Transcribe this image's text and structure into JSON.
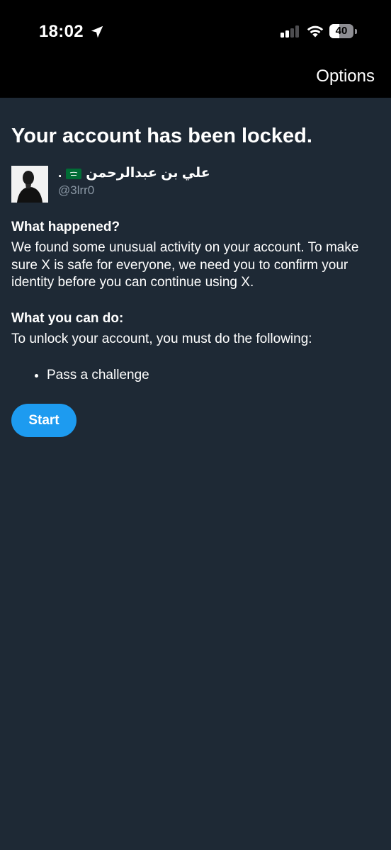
{
  "status_bar": {
    "time": "18:02",
    "battery": "40",
    "battery_level_percent": 40,
    "icons": [
      "location-arrow-icon",
      "cellular-signal-icon",
      "wifi-icon",
      "battery-icon"
    ]
  },
  "header": {
    "options_label": "Options"
  },
  "page": {
    "title": "Your account has been locked."
  },
  "user": {
    "display_name": "علي بن عبدالرحمن",
    "name_suffix": ".",
    "flag": "saudi-arabia-flag-icon",
    "handle": "@3lrr0"
  },
  "what_happened": {
    "heading": "What happened?",
    "body": "We found some unusual activity on your account. To make sure X is safe for everyone, we need you to confirm your identity before you can continue using X."
  },
  "what_you_can_do": {
    "heading": "What you can do:",
    "body": "To unlock your account, you must do the following:",
    "steps": [
      "Pass a challenge"
    ]
  },
  "actions": {
    "start_label": "Start"
  },
  "colors": {
    "background": "#1e2935",
    "top_bar": "#000000",
    "accent": "#1d9bf0",
    "secondary_text": "#8b98a5"
  }
}
